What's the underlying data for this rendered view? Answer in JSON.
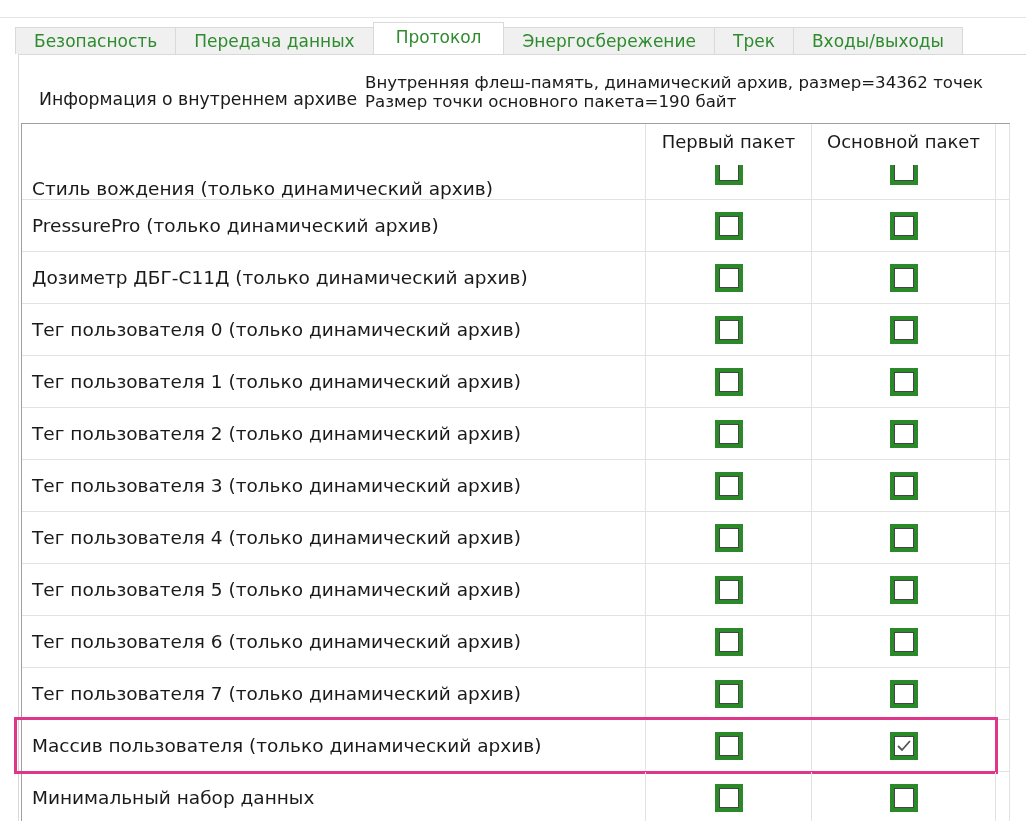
{
  "tabs": [
    {
      "label": "Безопасность",
      "selected": false
    },
    {
      "label": "Передача данных",
      "selected": false
    },
    {
      "label": "Протокол",
      "selected": true
    },
    {
      "label": "Энергосбережение",
      "selected": false
    },
    {
      "label": "Трек",
      "selected": false
    },
    {
      "label": "Входы/выходы",
      "selected": false
    }
  ],
  "archive_info": {
    "label": "Информация о внутреннем архиве",
    "lines": [
      "Внутренняя флеш-память, динамический архив, размер=34362 точек",
      "Размер точки основного пакета=190 байт"
    ]
  },
  "table": {
    "columns": [
      {
        "label": "Первый пакет"
      },
      {
        "label": "Основной пакет"
      }
    ],
    "rows": [
      {
        "name": "Стиль вождения (только динамический архив)",
        "first_packet": false,
        "main_packet": false,
        "highlighted": false,
        "partially_hidden": true
      },
      {
        "name": "PressurePro (только динамический архив)",
        "first_packet": false,
        "main_packet": false,
        "highlighted": false,
        "partially_hidden": false
      },
      {
        "name": "Дозиметр ДБГ-С11Д (только динамический архив)",
        "first_packet": false,
        "main_packet": false,
        "highlighted": false,
        "partially_hidden": false
      },
      {
        "name": "Тег пользователя 0 (только динамический архив)",
        "first_packet": false,
        "main_packet": false,
        "highlighted": false,
        "partially_hidden": false
      },
      {
        "name": "Тег пользователя 1 (только динамический архив)",
        "first_packet": false,
        "main_packet": false,
        "highlighted": false,
        "partially_hidden": false
      },
      {
        "name": "Тег пользователя 2 (только динамический архив)",
        "first_packet": false,
        "main_packet": false,
        "highlighted": false,
        "partially_hidden": false
      },
      {
        "name": "Тег пользователя 3 (только динамический архив)",
        "first_packet": false,
        "main_packet": false,
        "highlighted": false,
        "partially_hidden": false
      },
      {
        "name": "Тег пользователя 4 (только динамический архив)",
        "first_packet": false,
        "main_packet": false,
        "highlighted": false,
        "partially_hidden": false
      },
      {
        "name": "Тег пользователя 5 (только динамический архив)",
        "first_packet": false,
        "main_packet": false,
        "highlighted": false,
        "partially_hidden": false
      },
      {
        "name": "Тег пользователя 6 (только динамический архив)",
        "first_packet": false,
        "main_packet": false,
        "highlighted": false,
        "partially_hidden": false
      },
      {
        "name": "Тег пользователя 7 (только динамический архив)",
        "first_packet": false,
        "main_packet": false,
        "highlighted": false,
        "partially_hidden": false
      },
      {
        "name": "Массив пользователя (только динамический архив)",
        "first_packet": false,
        "main_packet": true,
        "highlighted": true,
        "partially_hidden": false
      },
      {
        "name": "Минимальный набор данных",
        "first_packet": false,
        "main_packet": false,
        "highlighted": false,
        "partially_hidden": false
      }
    ]
  }
}
